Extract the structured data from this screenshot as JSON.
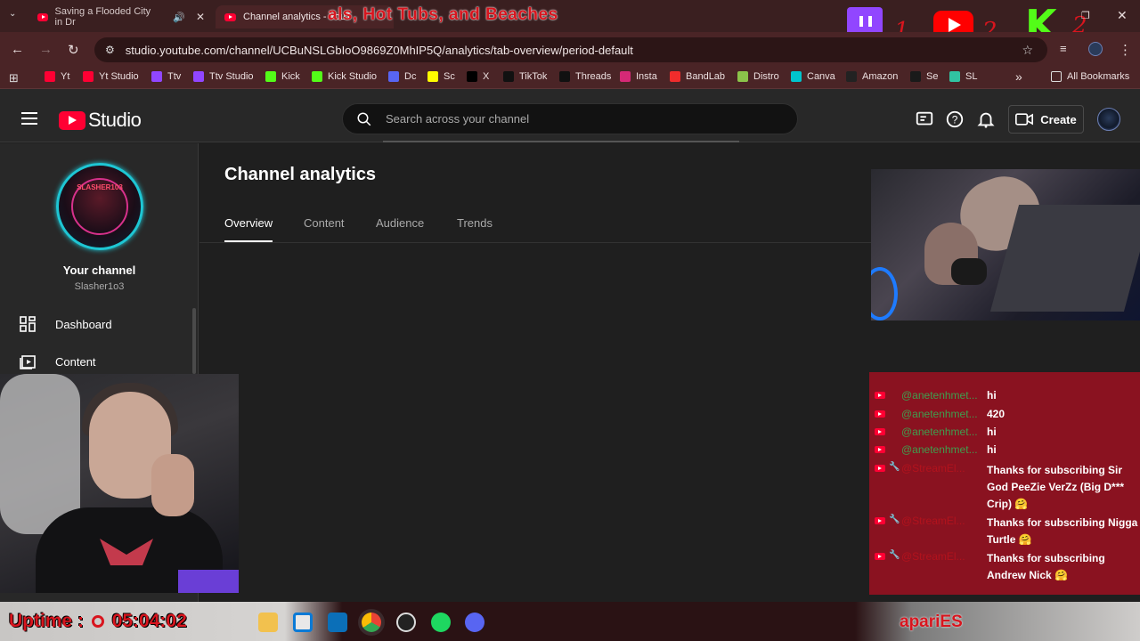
{
  "browser": {
    "tabs": [
      {
        "title": "Saving a Flooded City in Dr",
        "audio": true,
        "close": "✕"
      },
      {
        "title": "Channel analytics - YouTube S"
      }
    ],
    "url": "studio.youtube.com/channel/UCBuNSLGbIoO9869Z0MhIP5Q/analytics/tab-overview/period-default",
    "bookmarks": [
      {
        "label": "Yt",
        "icon": "youtube-icon",
        "color": "#ff0033"
      },
      {
        "label": "Yt Studio",
        "icon": "youtube-icon",
        "color": "#ff0033"
      },
      {
        "label": "Ttv",
        "icon": "twitch-icon",
        "color": "#9146ff"
      },
      {
        "label": "Ttv Studio",
        "icon": "twitch-icon",
        "color": "#9146ff"
      },
      {
        "label": "Kick",
        "icon": "kick-icon",
        "color": "#53fc18"
      },
      {
        "label": "Kick Studio",
        "icon": "kick-icon",
        "color": "#53fc18"
      },
      {
        "label": "Dc",
        "icon": "discord-icon",
        "color": "#5865f2"
      },
      {
        "label": "Sc",
        "icon": "snapchat-icon",
        "color": "#fffc00"
      },
      {
        "label": "X",
        "icon": "x-icon",
        "color": "#000000"
      },
      {
        "label": "TikTok",
        "icon": "tiktok-icon",
        "color": "#111111"
      },
      {
        "label": "Threads",
        "icon": "threads-icon",
        "color": "#111111"
      },
      {
        "label": "Insta",
        "icon": "instagram-icon",
        "color": "#d62976"
      },
      {
        "label": "BandLab",
        "icon": "bandlab-icon",
        "color": "#f12c2c"
      },
      {
        "label": "Distro",
        "icon": "distrokid-icon",
        "color": "#8bc34a"
      },
      {
        "label": "Canva",
        "icon": "canva-icon",
        "color": "#00c4cc"
      },
      {
        "label": "Amazon",
        "icon": "amazon-icon",
        "color": "#222222"
      },
      {
        "label": "Se",
        "icon": "streamelements-icon",
        "color": "#1a1a1a"
      },
      {
        "label": "SL",
        "icon": "streamlabs-icon",
        "color": "#31c3a2"
      }
    ],
    "more": "»",
    "all_bookmarks": "All Bookmarks"
  },
  "overlay": {
    "title_text": "als, Hot Tubs, and Beaches",
    "num1": "1",
    "num2": "2",
    "num3": "2",
    "kick_letter": "K",
    "uptime_label": "Uptime :",
    "uptime_value": "05:04:02",
    "brand": "apariES"
  },
  "studio": {
    "logo_text": "Studio",
    "search_placeholder": "Search across your channel",
    "create_label": "Create",
    "sidebar": {
      "channel_label": "Your channel",
      "handle": "Slasher1o3",
      "avatar_text": "SLASHER103",
      "items": [
        {
          "label": "Dashboard"
        },
        {
          "label": "Content"
        }
      ]
    },
    "main": {
      "title": "Channel analytics",
      "tabs": [
        "Overview",
        "Content",
        "Audience",
        "Trends"
      ],
      "active_tab": "Overview"
    }
  },
  "chat": {
    "messages": [
      {
        "user": "@anetenhmet...",
        "text": "hi"
      },
      {
        "user": "@anetenhmet...",
        "text": "420"
      },
      {
        "user": "@anetenhmet...",
        "text": "hi"
      },
      {
        "user": "@anetenhmet...",
        "text": "hi"
      },
      {
        "user": "@StreamEl...",
        "text": "Thanks for subscribing Sir God PeeZie VerZz (Big D*** Crip) 🤗",
        "bot": true
      },
      {
        "user": "@StreamEl...",
        "text": "Thanks for subscribing Nigga Turtle 🤗",
        "bot": true
      },
      {
        "user": "@StreamEl...",
        "text": "Thanks for subscribing Andrew Nick 🤗",
        "bot": true
      }
    ]
  },
  "colors": {
    "browser_frame": "#4a2426",
    "studio_bg": "#1f1f1f",
    "youtube_red": "#ff0033",
    "chat_bg": "#8a1220",
    "overlay_red": "#d8151e"
  }
}
